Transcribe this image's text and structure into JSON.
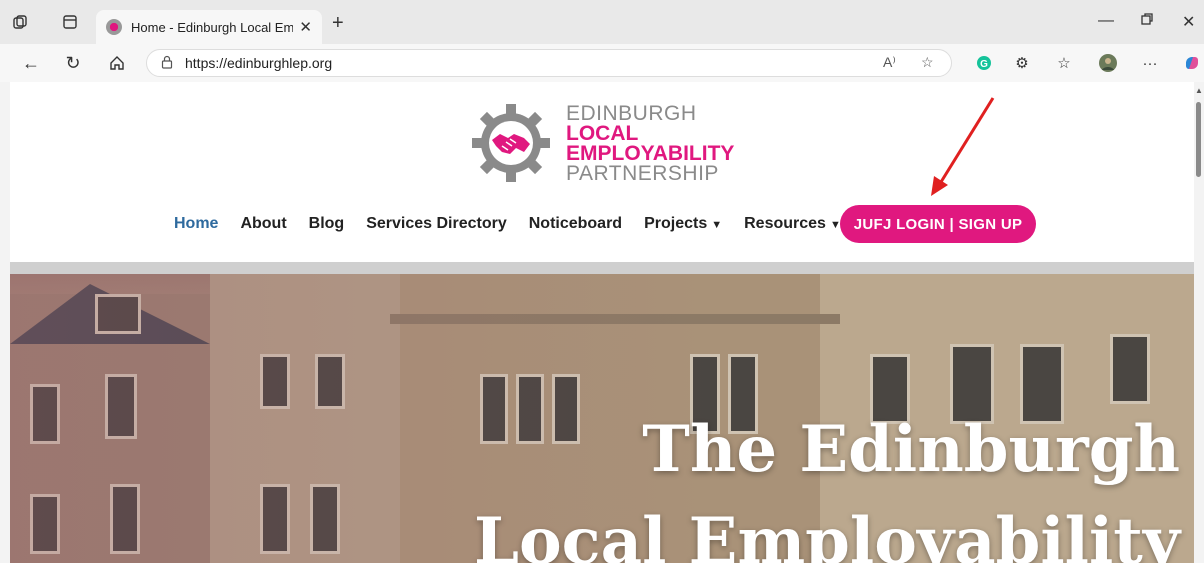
{
  "browser": {
    "tab_title": "Home - Edinburgh Local Employa",
    "url": "https://edinburghlep.org",
    "new_tab_symbol": "+",
    "read_aloud_glyph": "A⁾",
    "more_symbol": "···"
  },
  "site": {
    "logo": {
      "line1": "EDINBURGH",
      "line2": "LOCAL",
      "line3": "EMPLOYABILITY",
      "line4": "PARTNERSHIP"
    },
    "menu": [
      {
        "label": "Home",
        "active": true
      },
      {
        "label": "About"
      },
      {
        "label": "Blog"
      },
      {
        "label": "Services Directory"
      },
      {
        "label": "Noticeboard"
      },
      {
        "label": "Projects",
        "dropdown": true
      },
      {
        "label": "Resources",
        "dropdown": true
      }
    ],
    "cta_label": "JUFJ LOGIN | SIGN UP",
    "hero": {
      "line1": "The Edinburgh",
      "line2": "Local Employability"
    }
  },
  "colors": {
    "brand_pink": "#e0187f",
    "brand_grey": "#8a8a8a",
    "active_link": "#2e6a9e",
    "annotation_arrow": "#e02020"
  }
}
